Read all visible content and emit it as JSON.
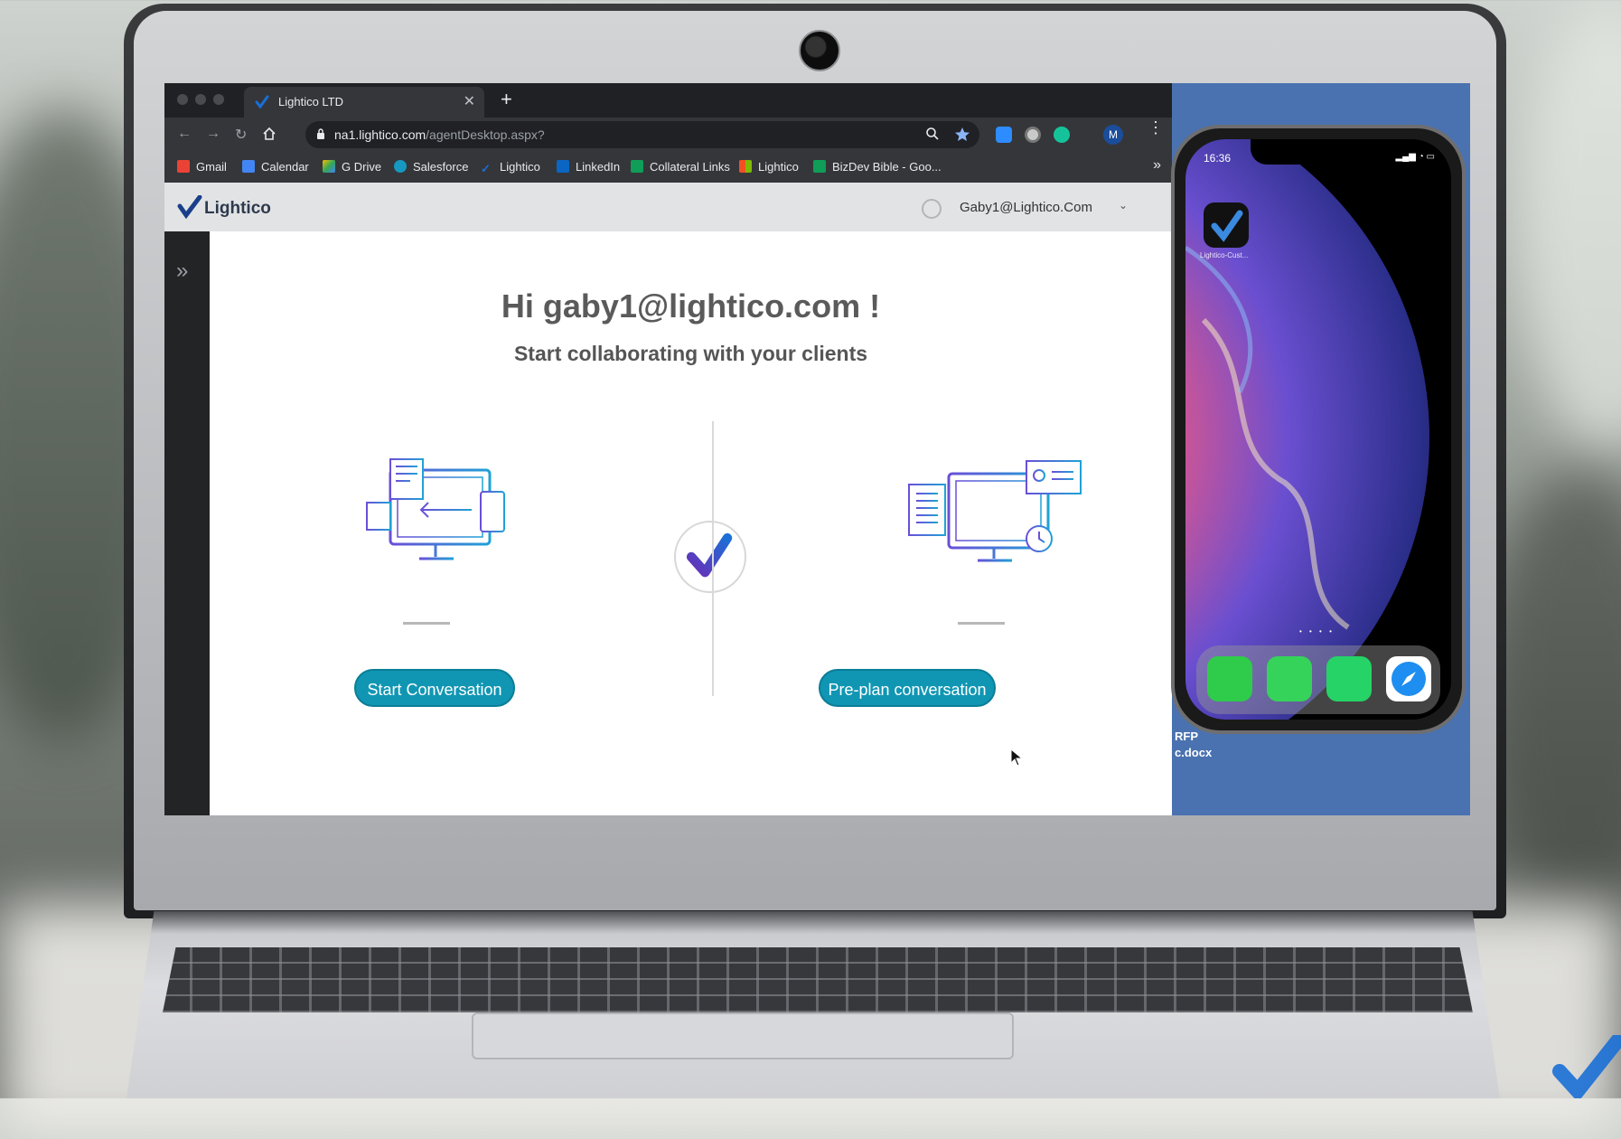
{
  "browser": {
    "tab_title": "Lightico LTD",
    "url_host": "na1.lightico.com",
    "url_path": "/agentDesktop.aspx?",
    "profile_initial": "M",
    "bookmarks": [
      "Gmail",
      "Calendar",
      "G Drive",
      "Salesforce",
      "Lightico",
      "LinkedIn",
      "Collateral Links",
      "Lightico",
      "BizDev Bible - Goo..."
    ],
    "more": "»"
  },
  "app": {
    "logo_text": "Lightico",
    "user_email": "Gaby1@Lightico.Com",
    "greeting": "Hi gaby1@lightico.com !",
    "subtitle": "Start collaborating with your clients",
    "start_button": "Start Conversation",
    "preplan_button": "Pre-plan conversation"
  },
  "phone": {
    "time": "16:36",
    "app_label": "Lightico-Cust..."
  },
  "desktop": {
    "file_line1": "RFP",
    "file_line2": "c.docx"
  },
  "colors": {
    "accent": "#1096b3",
    "brand_dark": "#2e3b4e",
    "desktop_blue": "#4a72b0"
  }
}
